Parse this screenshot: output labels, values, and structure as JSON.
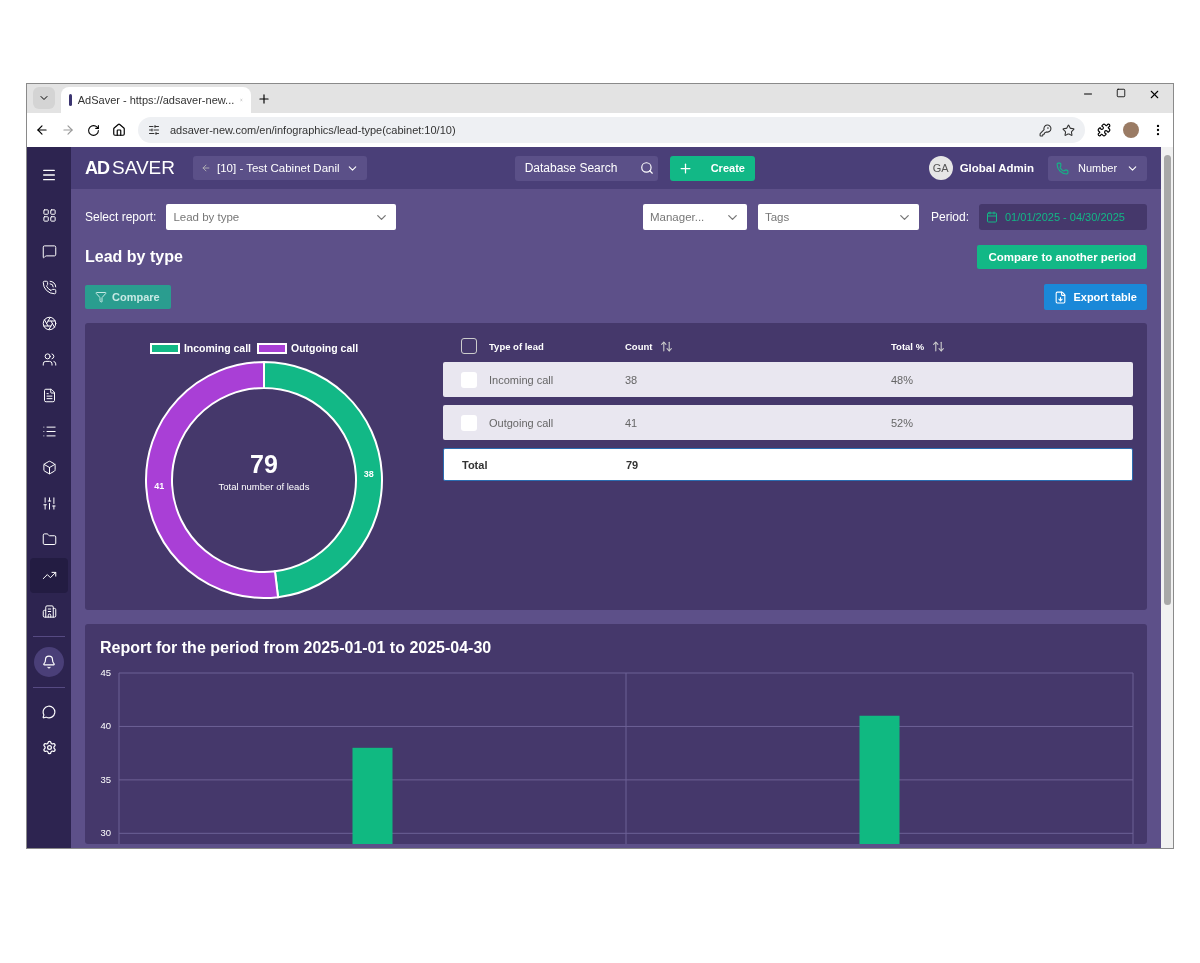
{
  "browser": {
    "tab_title": "AdSaver - https://adsaver-new...",
    "url": "adsaver-new.com/en/infographics/lead-type(cabinet:10/10)"
  },
  "topbar": {
    "logo_mark": "AD",
    "logo_text": "SAVER",
    "cabinet": "[10] - Test Cabinet Danil",
    "search_label": "Database Search",
    "create": "Create",
    "avatar": "GA",
    "user": "Global Admin",
    "number": "Number"
  },
  "sidebar": {
    "items": [
      {
        "selected": false
      },
      {
        "selected": false
      },
      {
        "selected": false
      },
      {
        "selected": false
      },
      {
        "selected": false
      },
      {
        "selected": false
      },
      {
        "selected": false
      },
      {
        "selected": false
      },
      {
        "selected": false
      },
      {
        "selected": false
      },
      {
        "selected": true
      },
      {
        "selected": false
      }
    ]
  },
  "filters": {
    "report_label": "Select report:",
    "report_value": "Lead by type",
    "manager_placeholder": "Manager...",
    "tags_placeholder": "Tags",
    "period_label": "Period:",
    "period_value": "01/01/2025 - 04/30/2025"
  },
  "title": "Lead by type",
  "compare_period": "Compare to another period",
  "compare": "Compare",
  "export": "Export table",
  "donut": {
    "legend": [
      {
        "color": "#12b886"
      },
      {
        "color": "#a93fd6"
      }
    ],
    "total": "79",
    "total_caption": "Total number of leads",
    "chart_data": {
      "type": "donut",
      "categories": [
        "Incoming call",
        "Outgoing call"
      ],
      "values": [
        38,
        41
      ],
      "data_labels": true
    }
  },
  "table": {
    "header_checked": false,
    "columns": [
      {
        "label": "Type of lead",
        "sortable": false
      },
      {
        "label": "Count",
        "sortable": true
      },
      {
        "label": "Total %",
        "sortable": true
      }
    ],
    "rows": [
      {
        "checked": false,
        "type": "Incoming call",
        "count": "38",
        "percent": "48%"
      },
      {
        "checked": false,
        "type": "Outgoing call",
        "count": "41",
        "percent": "52%"
      }
    ],
    "total": {
      "label": "Total",
      "count": "79"
    }
  },
  "report": {
    "title": "Report for the period from 2025-01-01 to 2025-04-30",
    "chart_data": {
      "type": "bar",
      "grid": true,
      "series": [
        {
          "color": "#10b981",
          "values": [
            38,
            41
          ]
        }
      ],
      "ylim": [
        29,
        45
      ],
      "yticks": [
        30,
        35,
        40,
        45
      ]
    }
  }
}
